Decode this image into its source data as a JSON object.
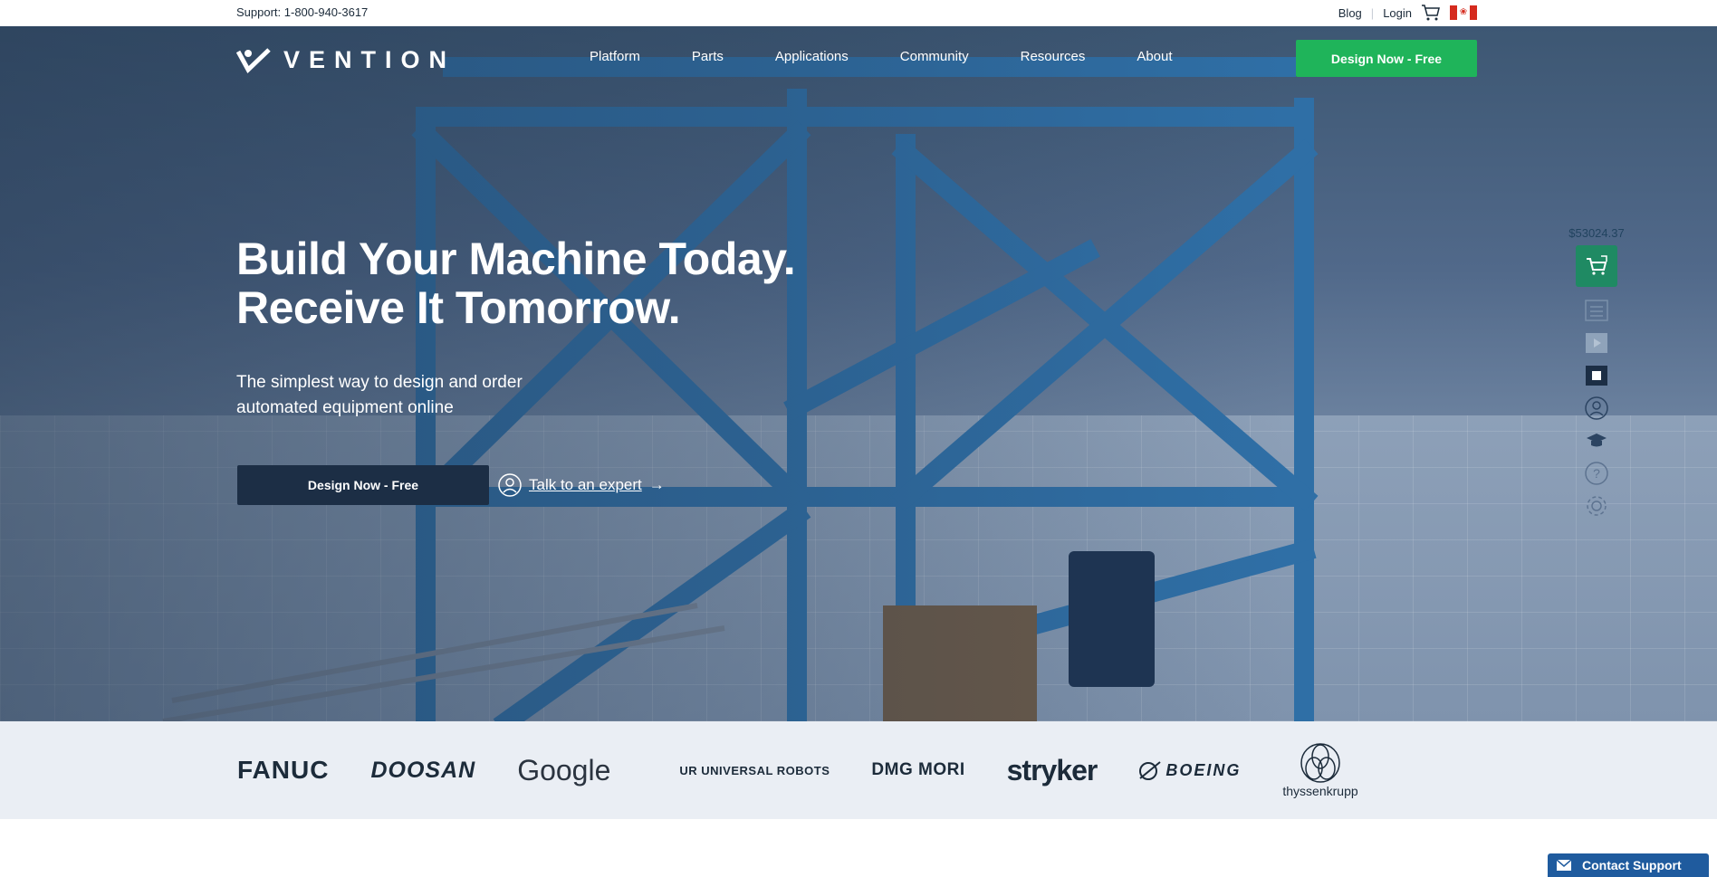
{
  "topbar": {
    "support_text": "Support: 1-800-940-3617",
    "blog": "Blog",
    "login": "Login",
    "cart_icon": "cart-icon",
    "flag_icon": "canada-flag-icon"
  },
  "nav": {
    "logo_text": "VENTION",
    "menu": [
      "Platform",
      "Parts",
      "Applications",
      "Community",
      "Resources",
      "About"
    ],
    "cta": "Design Now - Free"
  },
  "hero": {
    "headline_line1": "Build Your Machine Today.",
    "headline_line2": "Receive It Tomorrow.",
    "subhead": "The simplest way to design and order automated equipment online",
    "cta": "Design Now - Free",
    "expert_link": "Talk to an expert",
    "expert_arrow": "→"
  },
  "toolbar": {
    "price": "$53024.37",
    "icons": [
      "cart-expand-icon",
      "list-icon",
      "play-icon",
      "stop-icon",
      "expert-icon",
      "graduation-cap-icon",
      "help-icon",
      "settings-icon"
    ]
  },
  "logos": [
    "FANUC",
    "DOOSAN",
    "Google",
    "UNIVERSAL ROBOTS",
    "DMG MORI",
    "stryker",
    "BOEING",
    "thyssenkrupp"
  ],
  "contact_support": "Contact Support",
  "colors": {
    "accent_green": "#1fb45a",
    "navy": "#1c2e45",
    "contact_blue": "#1f5b9e",
    "logo_band": "#eaeef4"
  }
}
